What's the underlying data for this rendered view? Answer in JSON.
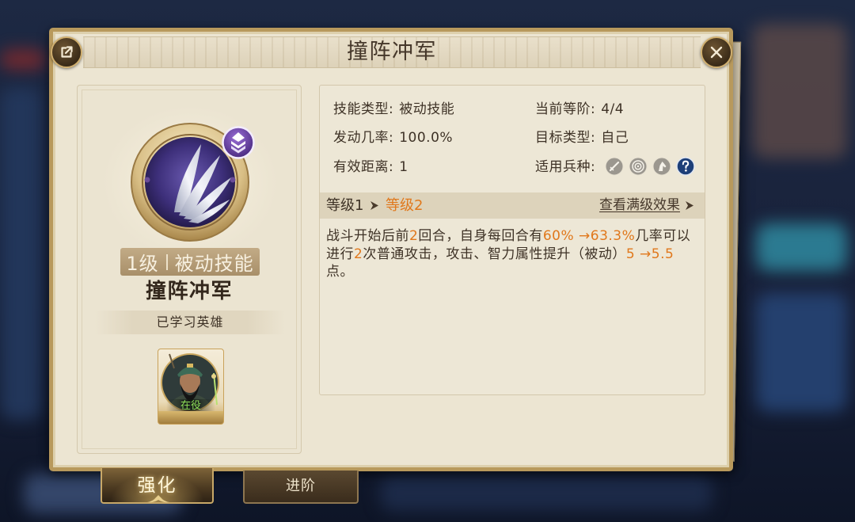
{
  "dialog": {
    "title": "撞阵冲军",
    "share_icon": "share-icon",
    "close_icon": "close-icon"
  },
  "skill_card": {
    "icon": "blades-skill-icon",
    "upgrade_badge_icon": "upgrade-badge-icon",
    "level": "1级",
    "type": "被动技能",
    "name": "撞阵冲军",
    "learned_heroes_label": "已学习英雄",
    "heroes": [
      {
        "portrait": "hero-portrait",
        "status": "在役"
      }
    ]
  },
  "info": {
    "skill_type": {
      "label": "技能类型:",
      "value": "被动技能"
    },
    "current_tier": {
      "label": "当前等阶:",
      "value": "4/4"
    },
    "trigger_rate": {
      "label": "发动几率:",
      "value": "100.0%"
    },
    "target_type": {
      "label": "目标类型:",
      "value": "自己"
    },
    "range": {
      "label": "有效距离:",
      "value": "1"
    },
    "unit_types": {
      "label": "适用兵种:",
      "icons": [
        "sword-icon",
        "target-icon",
        "horse-icon",
        "question-icon"
      ]
    }
  },
  "level_bar": {
    "from": "等级1",
    "to": "等级2",
    "arrow_icon": "arrow-right-icon",
    "view_max_label": "查看满级效果"
  },
  "description": {
    "lines": [
      [
        {
          "text": "战斗开始后前",
          "highlight": false
        },
        {
          "text": "2",
          "highlight": true
        },
        {
          "text": "回合，自身每回合有",
          "highlight": false
        },
        {
          "text": "60% →63.3%",
          "highlight": true
        },
        {
          "text": "几率可以",
          "highlight": false
        }
      ],
      [
        {
          "text": "进行",
          "highlight": false
        },
        {
          "text": "2",
          "highlight": true
        },
        {
          "text": "次普通攻击，攻击、智力属性提升（被动）",
          "highlight": false
        },
        {
          "text": "5 →5.5",
          "highlight": true
        }
      ],
      [
        {
          "text": "点。",
          "highlight": false
        }
      ]
    ]
  },
  "tabs": [
    {
      "label": "强化",
      "active": true
    },
    {
      "label": "进阶",
      "active": false
    }
  ],
  "colors": {
    "highlight": "#e0781c",
    "hero_status": "#8fe05a",
    "parchment": "#ece5d2",
    "frame_gold": "#b8995c"
  }
}
